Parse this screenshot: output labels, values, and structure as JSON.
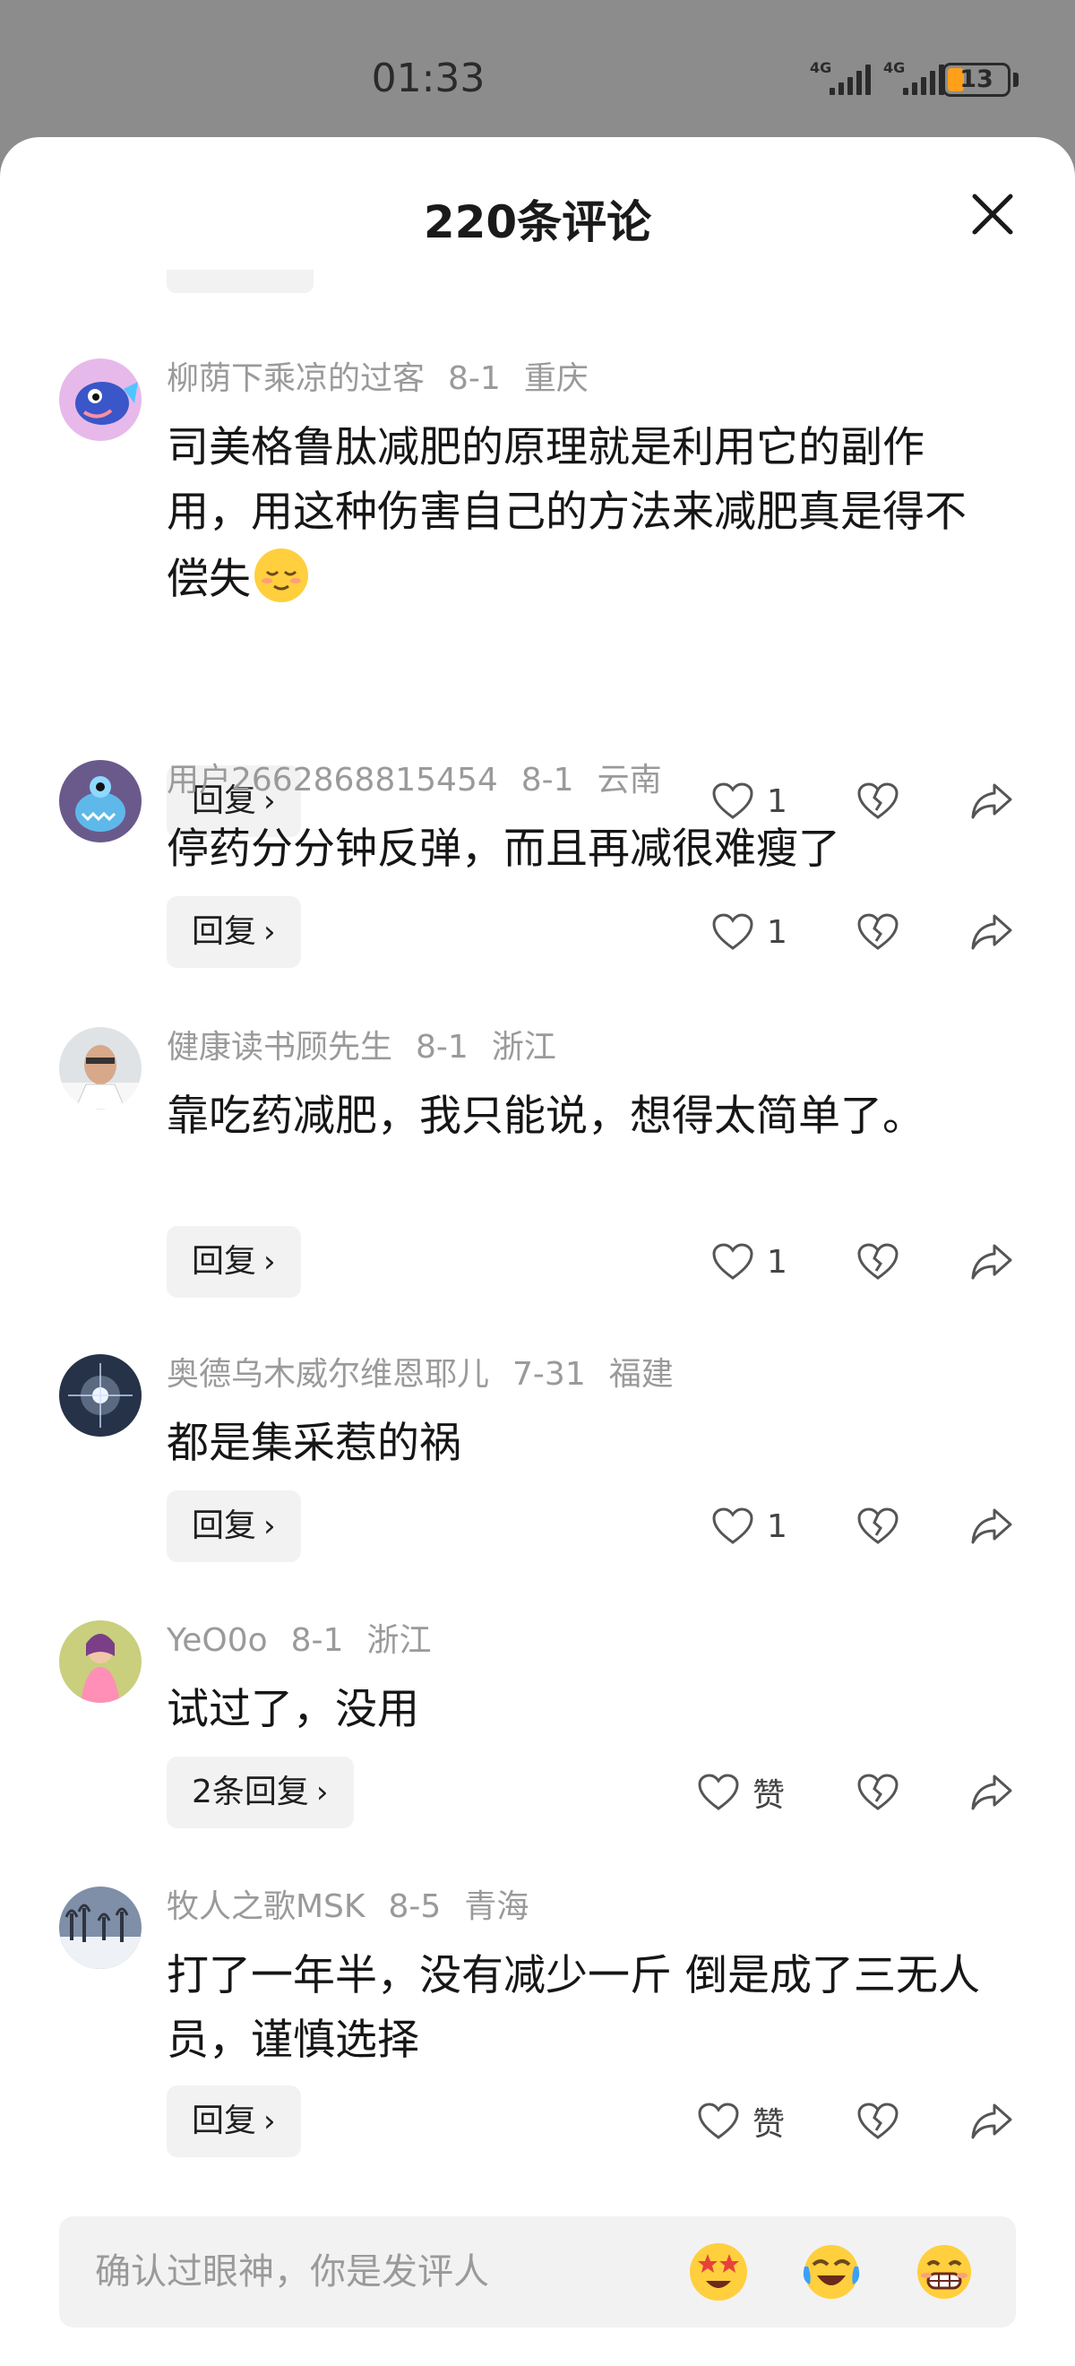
{
  "status": {
    "time": "01:33",
    "net1": "4G",
    "net2": "4G",
    "battery": "13"
  },
  "sheet": {
    "title": "220条评论"
  },
  "comments": [
    {
      "user": "柳荫下乘凉的过客",
      "date": "8-1",
      "region": "重庆",
      "text": "司美格鲁肽减肥的原理就是利用它的副作用，用这种伤害自己的方法来减肥真是得不偿失",
      "emoji": "relieved-face-emoji",
      "reply": "回复",
      "likes": "1"
    },
    {
      "user": "用户2662868815454",
      "date": "8-1",
      "region": "云南",
      "text": "停药分分钟反弹，而且再减很难瘦了",
      "reply": "回复",
      "likes": "1"
    },
    {
      "user": "健康读书顾先生",
      "date": "8-1",
      "region": "浙江",
      "text": "靠吃药减肥，我只能说，想得太简单了。",
      "reply": "回复",
      "likes": "1"
    },
    {
      "user": "奥德乌木威尔维恩耶儿",
      "date": "7-31",
      "region": "福建",
      "text": "都是集采惹的祸",
      "reply": "回复",
      "likes": "1"
    },
    {
      "user": "YeO0o",
      "date": "8-1",
      "region": "浙江",
      "text": "试过了，没用",
      "reply": "2条回复",
      "likes": "赞"
    },
    {
      "user": "牧人之歌MSK",
      "date": "8-5",
      "region": "青海",
      "text": "打了一年半，没有减少一斤 倒是成了三无人员，谨慎选择",
      "reply": "回复",
      "likes": "赞"
    }
  ],
  "input": {
    "placeholder": "确认过眼神，你是发评人"
  },
  "icons": [
    "close-icon",
    "heart-icon",
    "dislike-heart-icon",
    "share-icon",
    "chevron-right-icon",
    "star-eyes-emoji",
    "crying-laughing-emoji",
    "grinning-emoji"
  ],
  "colors": {
    "sheet_bg": "#ffffff",
    "backdrop": "#8c8c8c",
    "meta_text": "#9a9a9a",
    "pill_bg": "#f2f2f2",
    "battery": "#ff9f1a"
  }
}
